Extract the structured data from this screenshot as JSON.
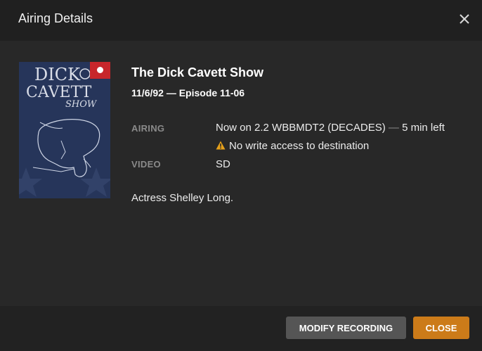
{
  "header": {
    "title": "Airing Details",
    "close_icon": "close-icon"
  },
  "poster": {
    "text_line1": "DICK",
    "text_line2": "CAVETT",
    "text_line3": "SHOW",
    "badge_icon": "record-dot-icon",
    "badge_color": "#c8262b"
  },
  "show": {
    "title": "The Dick Cavett Show",
    "episode_line": "11/6/92 — Episode 11-06"
  },
  "details": {
    "airing_label": "AIRING",
    "airing_value": "Now on 2.2 WBBMDT2 (DECADES)",
    "airing_separator": "—",
    "airing_time_left": "5 min left",
    "warning_text": "No write access to destination",
    "warning_icon": "warning-icon",
    "video_label": "VIDEO",
    "video_value": "SD"
  },
  "description": "Actress Shelley Long.",
  "footer": {
    "modify_label": "MODIFY RECORDING",
    "close_label": "CLOSE"
  },
  "colors": {
    "accent": "#cc7b19",
    "record": "#c8262b",
    "warning": "#e5a01a"
  }
}
